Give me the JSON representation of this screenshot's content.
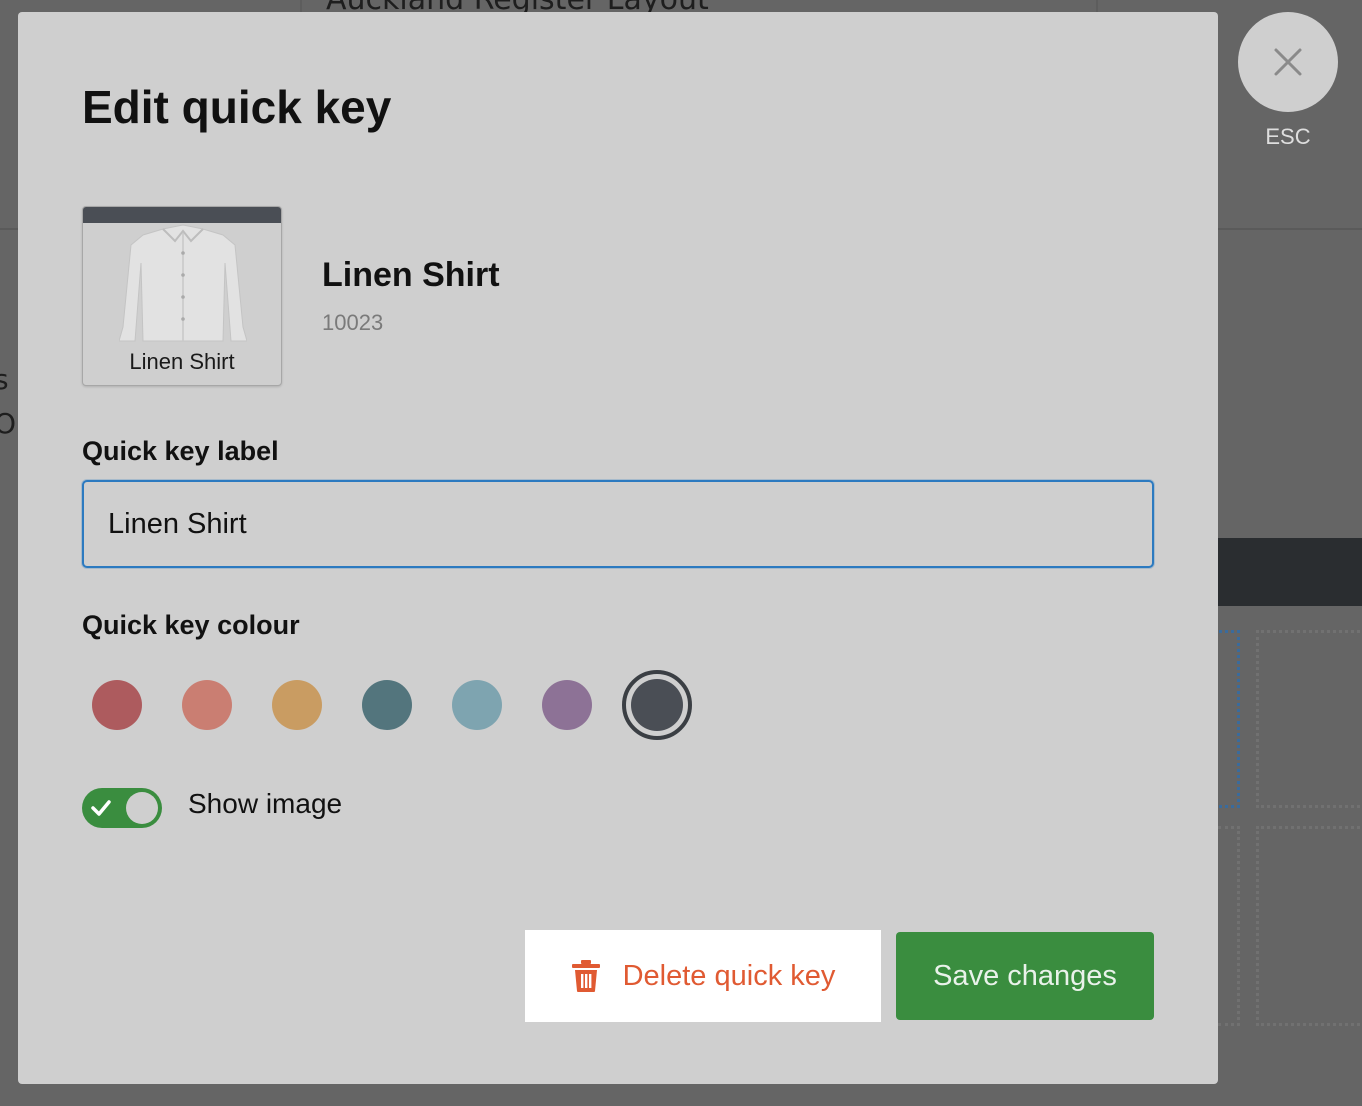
{
  "background": {
    "layout_title": "Auckland Register Layout",
    "side_text": [
      "s t",
      "Or"
    ]
  },
  "close": {
    "icon": "close-icon",
    "esc_label": "ESC"
  },
  "modal": {
    "title": "Edit quick key",
    "product": {
      "tile_label": "Linen Shirt",
      "tile_bar_color": "#4a4e55",
      "name": "Linen Shirt",
      "sku": "10023"
    },
    "label_field": {
      "label": "Quick key label",
      "value": "Linen Shirt"
    },
    "colour_field": {
      "label": "Quick key colour",
      "swatches": [
        "#ad5b5e",
        "#ca7e72",
        "#c99c62",
        "#53757d",
        "#7ea4b0",
        "#8d7296",
        "#4a4e55"
      ],
      "selected_index": 6
    },
    "show_image": {
      "label": "Show image",
      "enabled": true
    },
    "actions": {
      "delete_label": "Delete quick key",
      "save_label": "Save changes"
    }
  },
  "colors": {
    "accent_green": "#3a8d3f",
    "delete_red": "#e05a32",
    "focus_blue": "#2c7ac0"
  }
}
